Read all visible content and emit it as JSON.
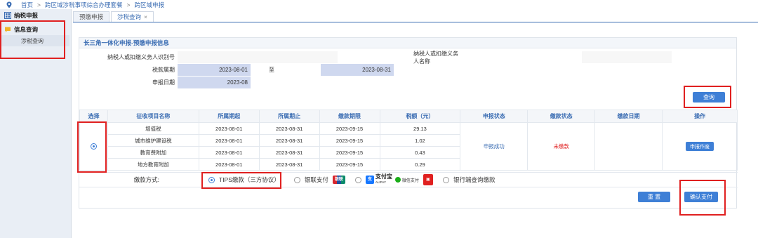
{
  "breadcrumb": {
    "home": "首页",
    "level2": "跨区域涉税事项综合办理套餐",
    "level3": "跨区域申报",
    "sep": ">"
  },
  "sidebar": {
    "items": [
      {
        "label": "纳税申报"
      },
      {
        "label": "信息查询"
      }
    ],
    "sub_items": [
      {
        "label": "涉税查询"
      }
    ]
  },
  "tabs": [
    {
      "label": "预缴申报"
    },
    {
      "label": "涉税查询",
      "close": "×"
    }
  ],
  "panel": {
    "title": "长三角一体化申报-预缴申报信息"
  },
  "form": {
    "taxpayer_id_label": "纳税人或扣缴义务人识别号",
    "taxpayer_id_value": "",
    "taxpayer_name_label": "纳税人或扣缴义务人名称",
    "taxpayer_name_value": "",
    "tax_period_label": "税款属期",
    "period_start": "2023-08-01",
    "period_to": "至",
    "period_end": "2023-08-31",
    "declare_date_label": "申报日期",
    "declare_date": "2023-08",
    "query_button": "查询"
  },
  "table": {
    "headers": [
      "选择",
      "征收项目名称",
      "所属期起",
      "所属期止",
      "缴款期限",
      "税额（元）",
      "申报状态",
      "缴款状态",
      "缴款日期",
      "操作"
    ],
    "rows": [
      {
        "item": "增值税",
        "start": "2023-08-01",
        "end": "2023-08-31",
        "deadline": "2023-09-15",
        "amount": "29.13"
      },
      {
        "item": "城市维护建设税",
        "start": "2023-08-01",
        "end": "2023-08-31",
        "deadline": "2023-09-15",
        "amount": "1.02"
      },
      {
        "item": "教育费附加",
        "start": "2023-08-01",
        "end": "2023-08-31",
        "deadline": "2023-09-15",
        "amount": "0.43"
      },
      {
        "item": "地方教育附加",
        "start": "2023-08-01",
        "end": "2023-08-31",
        "deadline": "2023-09-15",
        "amount": "0.29"
      }
    ],
    "declare_status": "申报成功",
    "pay_status": "未缴款",
    "pay_date": "",
    "action_button": "申报作废"
  },
  "payment": {
    "label": "缴款方式:",
    "options": [
      {
        "label": "TIPS缴款（三方协议）",
        "selected": true
      },
      {
        "label": "银联支付",
        "selected": false
      },
      {
        "label": "",
        "selected": false
      },
      {
        "label": "银行端查询缴款",
        "selected": false
      }
    ],
    "unionpay_logo_text": "银联",
    "alipay_text": "支付宝",
    "alipay_sub": "ALIPAY",
    "wechat_text": "微信支付",
    "reset_button": "重 置",
    "confirm_button": "确认支付"
  },
  "colors": {
    "accent": "#3e7fd6",
    "highlight": "#e02020",
    "shade": "#cfd8ef",
    "unpaid": "#e02020"
  }
}
